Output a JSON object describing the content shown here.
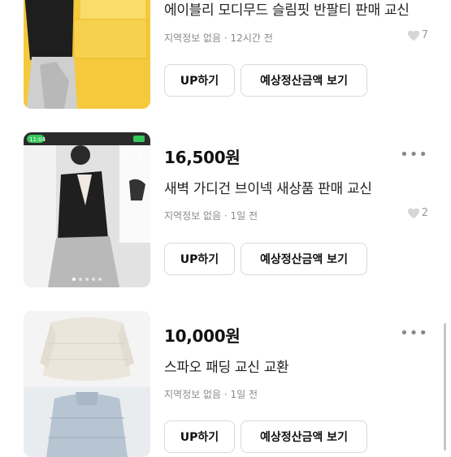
{
  "items": [
    {
      "price": "",
      "title": "에이블리 모디무드 슬림핏 반팔티 판매 교신",
      "location": "지역정보 없음",
      "time": "12시간 전",
      "likes": "7",
      "up_label": "UP하기",
      "settle_label": "예상정산금액 보기"
    },
    {
      "price": "16,500원",
      "title": "새벽 가디건 브이넥 새상품 판매 교신",
      "location": "지역정보 없음",
      "time": "1일 전",
      "likes": "2",
      "up_label": "UP하기",
      "settle_label": "예상정산금액 보기",
      "thumb_status_time": "11:04"
    },
    {
      "price": "10,000원",
      "title": "스파오 패딩 교신 교환",
      "location": "지역정보 없음",
      "time": "1일 전",
      "likes": "",
      "up_label": "UP하기",
      "settle_label": "예상정산금액 보기"
    }
  ],
  "separator": "·",
  "more_glyph": "•••",
  "colors": {
    "text": "#111111",
    "meta": "#8a8a8a",
    "border": "#d9d9d9",
    "thumb1_bg": "#f7d24a"
  },
  "icons": [
    "heart-icon",
    "more-icon",
    "home-icon",
    "search-icon"
  ]
}
